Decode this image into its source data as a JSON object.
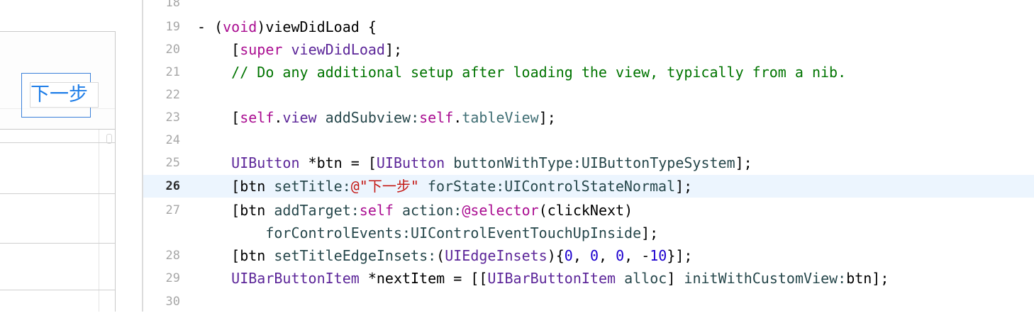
{
  "preview": {
    "button_label": "下一步"
  },
  "editor": {
    "lines": [
      {
        "num": "18",
        "tokens": []
      },
      {
        "num": "19",
        "tokens": [
          {
            "t": "- (",
            "c": "fn"
          },
          {
            "t": "void",
            "c": "kw"
          },
          {
            "t": ")viewDidLoad {",
            "c": "fn"
          }
        ]
      },
      {
        "num": "20",
        "tokens": [
          {
            "t": "    [",
            "c": "fn"
          },
          {
            "t": "super",
            "c": "kw"
          },
          {
            "t": " ",
            "c": "fn"
          },
          {
            "t": "viewDidLoad",
            "c": "cls"
          },
          {
            "t": "];",
            "c": "fn"
          }
        ]
      },
      {
        "num": "21",
        "tokens": [
          {
            "t": "    // Do any additional setup after loading the view, typically from a nib.",
            "c": "cmt"
          }
        ]
      },
      {
        "num": "22",
        "tokens": []
      },
      {
        "num": "23",
        "tokens": [
          {
            "t": "    [",
            "c": "fn"
          },
          {
            "t": "self",
            "c": "kw"
          },
          {
            "t": ".",
            "c": "fn"
          },
          {
            "t": "view",
            "c": "cls"
          },
          {
            "t": " ",
            "c": "fn"
          },
          {
            "t": "addSubview:",
            "c": "mth"
          },
          {
            "t": "self",
            "c": "kw"
          },
          {
            "t": ".",
            "c": "fn"
          },
          {
            "t": "tableView",
            "c": "prop"
          },
          {
            "t": "];",
            "c": "fn"
          }
        ]
      },
      {
        "num": "24",
        "tokens": []
      },
      {
        "num": "25",
        "tokens": [
          {
            "t": "    ",
            "c": "fn"
          },
          {
            "t": "UIButton",
            "c": "cls"
          },
          {
            "t": " *btn = [",
            "c": "fn"
          },
          {
            "t": "UIButton",
            "c": "cls"
          },
          {
            "t": " ",
            "c": "fn"
          },
          {
            "t": "buttonWithType:",
            "c": "mth"
          },
          {
            "t": "UIButtonTypeSystem",
            "c": "mth"
          },
          {
            "t": "];",
            "c": "fn"
          }
        ]
      },
      {
        "num": "26",
        "current": true,
        "tokens": [
          {
            "t": "    [btn ",
            "c": "fn"
          },
          {
            "t": "setTitle:",
            "c": "mth"
          },
          {
            "t": "@\"下一步\"",
            "c": "str"
          },
          {
            "t": " ",
            "c": "fn"
          },
          {
            "t": "forState:",
            "c": "mth"
          },
          {
            "t": "UIControlStateNormal",
            "c": "mth"
          },
          {
            "t": "];",
            "c": "fn"
          }
        ]
      },
      {
        "num": "27",
        "tokens": [
          {
            "t": "    [btn ",
            "c": "fn"
          },
          {
            "t": "addTarget:",
            "c": "mth"
          },
          {
            "t": "self",
            "c": "kw"
          },
          {
            "t": " ",
            "c": "fn"
          },
          {
            "t": "action:",
            "c": "mth"
          },
          {
            "t": "@selector",
            "c": "kw"
          },
          {
            "t": "(clickNext)",
            "c": "fn"
          }
        ]
      },
      {
        "num": "",
        "tokens": [
          {
            "t": "        ",
            "c": "fn"
          },
          {
            "t": "forControlEvents:",
            "c": "mth"
          },
          {
            "t": "UIControlEventTouchUpInside",
            "c": "mth"
          },
          {
            "t": "];",
            "c": "fn"
          }
        ]
      },
      {
        "num": "28",
        "tokens": [
          {
            "t": "    [btn ",
            "c": "fn"
          },
          {
            "t": "setTitleEdgeInsets:",
            "c": "mth"
          },
          {
            "t": "(",
            "c": "fn"
          },
          {
            "t": "UIEdgeInsets",
            "c": "cls"
          },
          {
            "t": "){",
            "c": "fn"
          },
          {
            "t": "0",
            "c": "num"
          },
          {
            "t": ", ",
            "c": "fn"
          },
          {
            "t": "0",
            "c": "num"
          },
          {
            "t": ", ",
            "c": "fn"
          },
          {
            "t": "0",
            "c": "num"
          },
          {
            "t": ", -",
            "c": "fn"
          },
          {
            "t": "10",
            "c": "num"
          },
          {
            "t": "}];",
            "c": "fn"
          }
        ]
      },
      {
        "num": "29",
        "tokens": [
          {
            "t": "    ",
            "c": "fn"
          },
          {
            "t": "UIBarButtonItem",
            "c": "cls"
          },
          {
            "t": " *nextItem = [[",
            "c": "fn"
          },
          {
            "t": "UIBarButtonItem",
            "c": "cls"
          },
          {
            "t": " ",
            "c": "fn"
          },
          {
            "t": "alloc",
            "c": "mth"
          },
          {
            "t": "] ",
            "c": "fn"
          },
          {
            "t": "initWithCustomView:",
            "c": "mth"
          },
          {
            "t": "btn];",
            "c": "fn"
          }
        ]
      },
      {
        "num": "30",
        "tokens": []
      }
    ]
  }
}
